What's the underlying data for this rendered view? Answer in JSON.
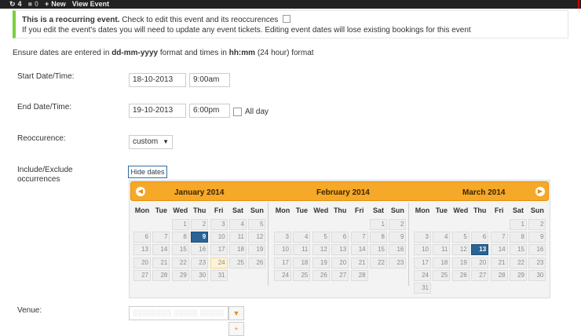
{
  "adminbar": {
    "update_count": "4",
    "comment_count": "0",
    "new_label": "New",
    "view_label": "View Event"
  },
  "notice": {
    "line1_bold": "This is a reocurring event.",
    "line1_rest": "Check to edit this event and its reoccurences",
    "line2": "If you edit the event's dates you will need to update any event tickets. Editing event dates will lose existing bookings for this event"
  },
  "hint": {
    "prefix": "Ensure dates are entered in",
    "date_format": "dd-mm-yyyy",
    "middle": "format and times in",
    "time_format": "hh:mm",
    "suffix": "(24 hour) format"
  },
  "form": {
    "start_label": "Start Date/Time:",
    "start_date": "18-10-2013",
    "start_time": "9:00am",
    "end_label": "End Date/Time:",
    "end_date": "19-10-2013",
    "end_time": "6:00pm",
    "allday_label": "All day",
    "reoccurence_label": "Reoccurence:",
    "reoccurence_value": "custom",
    "include_label_1": "Include/Exclude",
    "include_label_2": "occurrences",
    "hide_dates_label": "Hide dates",
    "venue_label": "Venue:",
    "venue_value": "░░░░░░░░ ░░░░░ ░░░░░"
  },
  "calendar": {
    "weekdays": [
      "Mon",
      "Tue",
      "Wed",
      "Thu",
      "Fri",
      "Sat",
      "Sun"
    ],
    "months": [
      {
        "title": "January 2014",
        "offset": 2,
        "days": 31,
        "selected": 9,
        "today": 24
      },
      {
        "title": "February 2014",
        "offset": 5,
        "days": 28,
        "selected": null,
        "today": null
      },
      {
        "title": "March 2014",
        "offset": 5,
        "days": 31,
        "selected": 13,
        "today": null
      }
    ]
  }
}
